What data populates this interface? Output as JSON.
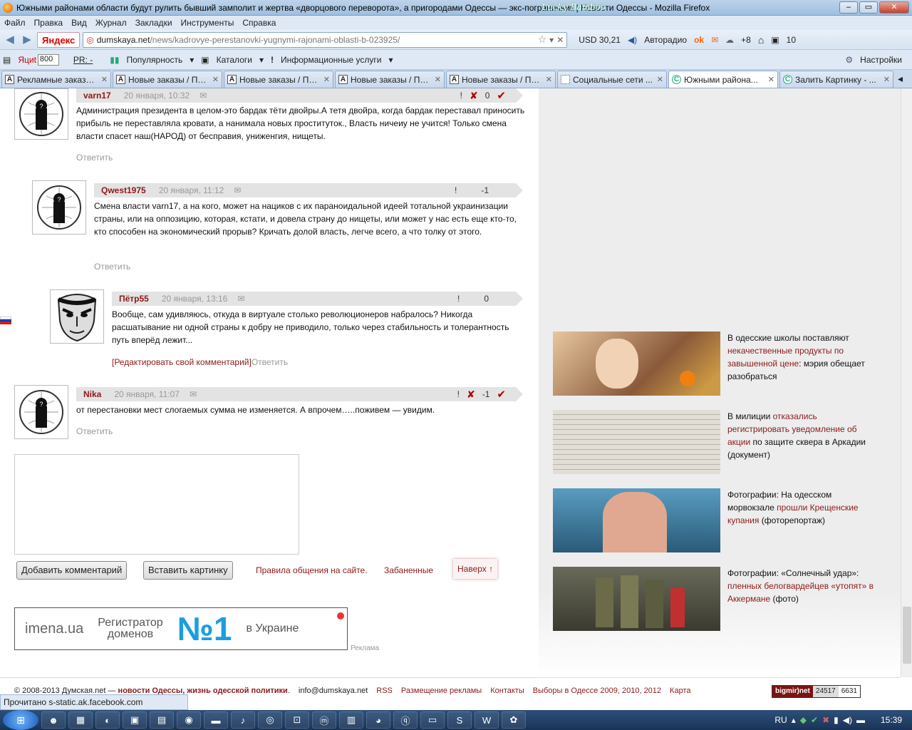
{
  "window": {
    "title": "Южными районами области будут рулить бывший замполит и жертва «дворцового переворота», а пригородами Одессы — экс-пограничник | Новости Одессы - Mozilla Firefox",
    "brand": "Lucky Bamboo"
  },
  "menu": [
    "Файл",
    "Правка",
    "Вид",
    "Журнал",
    "Закладки",
    "Инструменты",
    "Справка"
  ],
  "nav": {
    "yandex": "Яндекс",
    "url_domain": "dumskaya.net",
    "url_path": "/news/kadrovye-perestanovki-yugnymi-rajonami-oblasti-b-023925/",
    "usd": "USD 30,21",
    "radio": "Авторадио",
    "weather": "+8",
    "count": "10"
  },
  "bookmarks": {
    "yaci_label": "Яциt",
    "yaci_value": "800",
    "pr_label": "PR: -",
    "popularity": "Популярность",
    "catalogs": "Каталоги",
    "info": "Информационные услуги",
    "settings": "Настройки"
  },
  "tabs": [
    {
      "icon": "A",
      "label": "Рекламные заказы..."
    },
    {
      "icon": "A",
      "label": "Новые заказы / По..."
    },
    {
      "icon": "A",
      "label": "Новые заказы / По..."
    },
    {
      "icon": "A",
      "label": "Новые заказы / По..."
    },
    {
      "icon": "A",
      "label": "Новые заказы / По..."
    },
    {
      "icon": "",
      "label": "Социальные сети ..."
    },
    {
      "icon": "C",
      "label": "Южными района..."
    },
    {
      "icon": "C",
      "label": "Залить Картинку - ..."
    }
  ],
  "comments": [
    {
      "author": "varn17",
      "date": "20 января, 10:32",
      "vote": "0",
      "text": "Администрация президента в целом-это бардак тёти двойры.А тетя двойра, когда бардак переставал приносить прибыль не переставляла кровати, а нанимала новых проституток., Власть ничеиу не учится! Только смена власти спасет наш(НАРОД) от бесправия, униженгия, нищеты.",
      "reply": "Ответить"
    },
    {
      "author": "Qwest1975",
      "date": "20 января, 11:12",
      "vote": "-1",
      "text": "Смена власти varn17, а на кого, может на нациков с их параноидальной идеей тотальной украинизации страны, или на оппозицию, которая, кстати, и довела страну до нищеты, или может у нас есть еще кто-то, кто способен на экономический прорыв? Кричать долой власть, легче всего, а что толку от этого.",
      "reply": "Ответить"
    },
    {
      "author": "Пётр55",
      "date": "20 января, 13:16",
      "vote": "0",
      "text": "Вообще, сам удивляюсь, откуда в виртуале столько революционеров набралось? Никогда расшатывание ни одной страны к добру не приводило, только через стабильность и толерантность путь вперёд лежит...",
      "edit": "[Редактировать свой комментарий]",
      "reply": "Ответить"
    },
    {
      "author": "Nika",
      "date": "20 января, 11:07",
      "vote": "-1",
      "text": "от перестановки мест слогаемых сумма не изменяется. А впрочем…..поживем — увидим.",
      "reply": "Ответить"
    }
  ],
  "form": {
    "add_comment": "Добавить комментарий",
    "insert_image": "Вставить картинку",
    "rules": "Правила общения на сайте.",
    "banned": "Забаненные",
    "top": "Наверх ↑"
  },
  "banner": {
    "logo": "imena.ua",
    "text1": "Регистратор",
    "text2": "доменов",
    "big": "№1",
    "text3": "в Украине",
    "ad_label": "Реклама"
  },
  "news": [
    {
      "pre": "В одесские школы поставляют ",
      "link": "некачественные продукты по завышенной цене",
      "post": ": мэрия обещает разобраться",
      "img": "#c89a6a"
    },
    {
      "pre": "В милиции ",
      "link": "отказались регистрировать уведомление об акции",
      "post": " по защите сквера в Аркадии (документ)",
      "img": "#d8d4cc"
    },
    {
      "pre": "Фотографии: На одесском морвокзале ",
      "link": "прошли Крещенские купания",
      "post": " (фоторепортаж)",
      "img": "#4a86a8"
    },
    {
      "pre": "Фотографии: «Солнечный удар»: ",
      "link": "пленных белогвардейцев «утопят» в Аккермане",
      "post": " (фото)",
      "img": "#5a5a4a"
    }
  ],
  "footer": {
    "copy": "© 2008-2013 Думская.net — ",
    "tagline": "новости Одессы, жизнь одесской политики",
    "email": "info@dumskaya.net",
    "links": [
      "RSS",
      "Размещение рекламы",
      "Контакты",
      "Выборы в Одессе 2009, 2010, 2012",
      "Карта"
    ],
    "counter_name": "bigmir)net",
    "counter1": "24517",
    "counter2": "6631"
  },
  "status": "Прочитано s-static.ak.facebook.com",
  "taskbar": {
    "lang": "RU",
    "time": "15:39"
  }
}
